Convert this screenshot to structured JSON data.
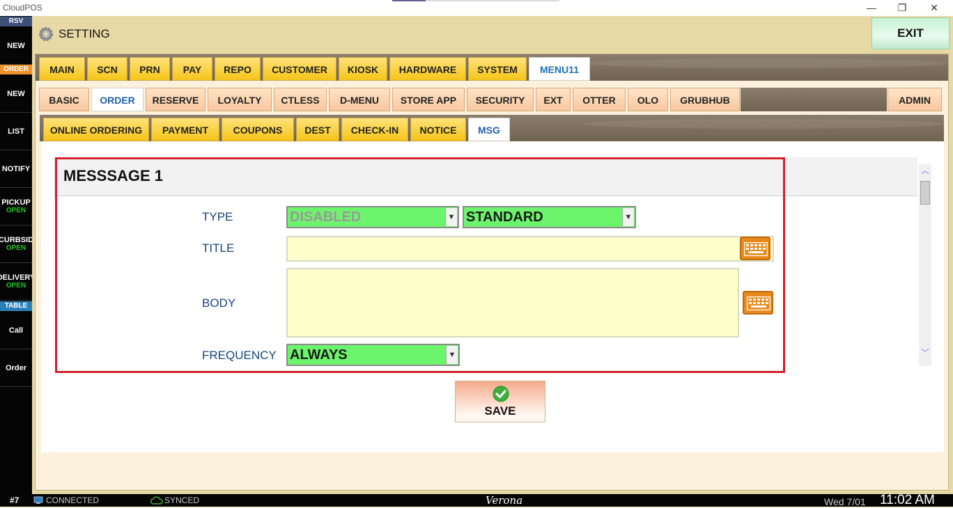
{
  "window": {
    "title": "CloudPOS",
    "controls": [
      "—",
      "❐",
      "✕"
    ]
  },
  "sidebar": {
    "rsv_label": "RSV",
    "order_label": "ORDER",
    "table_label": "TABLE",
    "items": [
      {
        "label": "NEW",
        "sub": ""
      },
      {
        "label": "NEW",
        "sub": ""
      },
      {
        "label": "LIST",
        "sub": ""
      },
      {
        "label": "NOTIFY",
        "sub": ""
      },
      {
        "label": "PICKUP",
        "sub": "OPEN"
      },
      {
        "label": "CURBSID",
        "sub": "OPEN"
      },
      {
        "label": "DELIVERY",
        "sub": "OPEN"
      },
      {
        "label": "Call",
        "sub": ""
      },
      {
        "label": "Order",
        "sub": ""
      }
    ],
    "colors": {
      "rsv": "#3e4f7a",
      "order": "#f0902a",
      "table": "#2b7fb8"
    }
  },
  "header": {
    "title": "SETTING",
    "exit_label": "EXIT"
  },
  "tabs_row1": [
    "MAIN",
    "SCN",
    "PRN",
    "PAY",
    "REPO",
    "CUSTOMER",
    "KIOSK",
    "HARDWARE",
    "SYSTEM",
    "MENU11"
  ],
  "tabs_row1_active": "MENU11",
  "tabs_row2": [
    "BASIC",
    "ORDER",
    "RESERVE",
    "LOYALTY",
    "CTLESS",
    "D-MENU",
    "STORE APP",
    "SECURITY",
    "EXT",
    "OTTER",
    "OLO",
    "GRUBHUB"
  ],
  "tabs_row2_active": "ORDER",
  "tabs_row2_right": "ADMIN",
  "tabs_row3": [
    "ONLINE ORDERING",
    "PAYMENT",
    "COUPONS",
    "DEST",
    "CHECK-IN",
    "NOTICE",
    "MSG"
  ],
  "tabs_row3_active": "MSG",
  "message": {
    "heading": "MESSSAGE 1",
    "type_label": "TYPE",
    "type_value1": "DISABLED",
    "type_value2": "STANDARD",
    "title_label": "TITLE",
    "title_value": "",
    "body_label": "BODY",
    "body_value": "",
    "frequency_label": "FREQUENCY",
    "frequency_value": "ALWAYS"
  },
  "save_label": "SAVE",
  "status": {
    "station": "#7",
    "connected": "CONNECTED",
    "synced": "SYNCED",
    "location": "Verona",
    "date": "Wed 7/01",
    "time": "11:02 AM"
  }
}
